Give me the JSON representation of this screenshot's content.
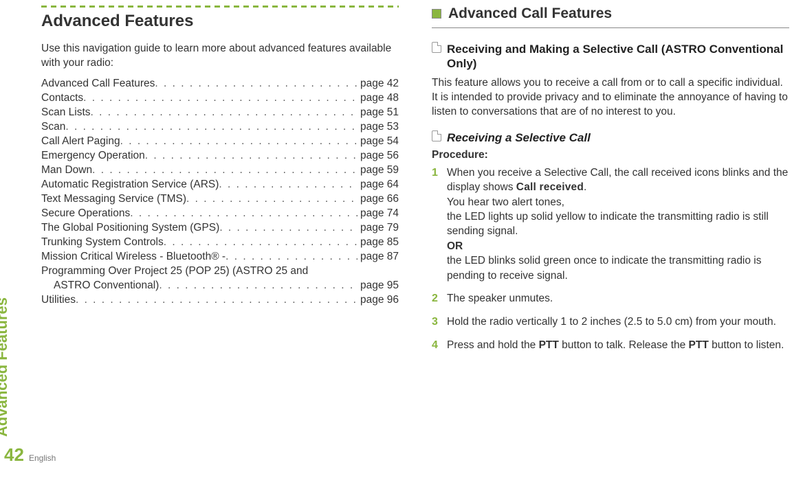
{
  "side": {
    "label": "Advanced Features",
    "page": "42",
    "lang": "English"
  },
  "left": {
    "title": "Advanced Features",
    "intro": "Use this navigation guide to learn more about advanced features available with your radio:",
    "toc": [
      {
        "label": "Advanced Call Features",
        "page": "page 42"
      },
      {
        "label": "Contacts",
        "page": "page 48"
      },
      {
        "label": "Scan Lists",
        "page": "page 51"
      },
      {
        "label": "Scan",
        "page": "page 53"
      },
      {
        "label": "Call Alert Paging",
        "page": "page 54"
      },
      {
        "label": "Emergency Operation",
        "page": "page 56"
      },
      {
        "label": "Man Down",
        "page": "page 59"
      },
      {
        "label": "Automatic Registration Service (ARS)",
        "page": "page 64"
      },
      {
        "label": "Text Messaging Service (TMS)",
        "page": "page 66"
      },
      {
        "label": "Secure Operations",
        "page": "page 74"
      },
      {
        "label": "The Global Positioning System (GPS)",
        "page": "page 79"
      },
      {
        "label": "Trunking System Controls",
        "page": "page 85"
      },
      {
        "label": "Mission Critical Wireless - Bluetooth® -",
        "page": "page 87"
      }
    ],
    "toc_wrap": {
      "line1": "Programming Over Project 25 (POP 25) (ASTRO 25 and",
      "line2_label": "ASTRO Conventional)",
      "line2_page": "page 95"
    },
    "toc_last": {
      "label": "Utilities",
      "page": "page 96"
    }
  },
  "right": {
    "section": "Advanced Call Features",
    "sub1": "Receiving and Making a Selective Call (ASTRO Conventional Only)",
    "para1": "This feature allows you to receive a call from or to call a specific individual. It is intended to provide privacy and to eliminate the annoyance of having to listen to conversations that are of no interest to you.",
    "sub2": "Receiving a Selective Call",
    "procedure": "Procedure:",
    "step1a": "When you receive a Selective Call, the call received icons blinks and the display shows ",
    "step1a_ui": "Call received",
    "step1a_end": ".",
    "step1b": "You hear two alert tones,",
    "step1c": "the LED lights up solid yellow to indicate the transmitting radio is still sending signal.",
    "step1_or": "OR",
    "step1d": "the LED blinks solid green once to indicate the transmitting radio is pending to receive signal.",
    "step2": "The speaker unmutes.",
    "step3": "Hold the radio vertically 1 to 2 inches (2.5 to 5.0 cm) from your mouth.",
    "step4_a": "Press and hold the ",
    "step4_ptt1": "PTT",
    "step4_b": " button to talk. Release the ",
    "step4_ptt2": "PTT",
    "step4_c": " button to listen.",
    "nums": {
      "n1": "1",
      "n2": "2",
      "n3": "3",
      "n4": "4"
    }
  }
}
